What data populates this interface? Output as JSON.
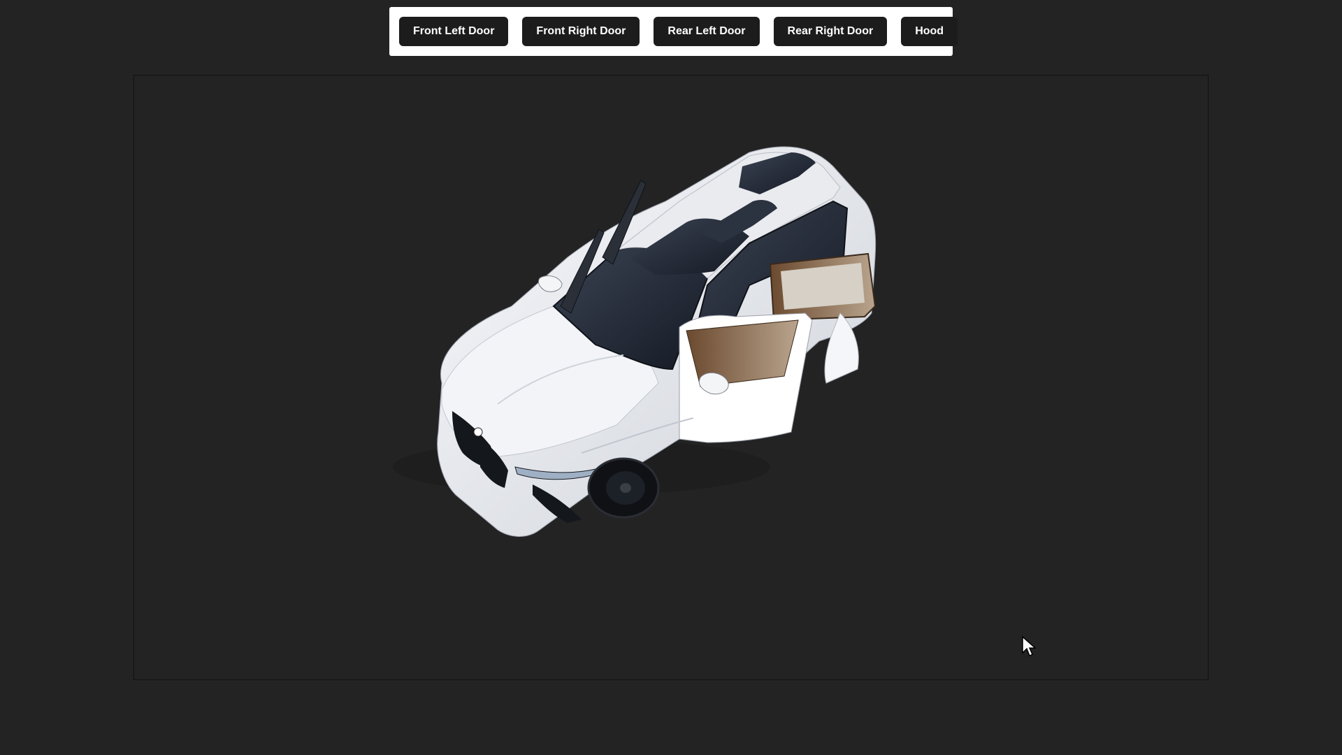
{
  "toolbar": {
    "buttons": [
      {
        "label": "Front Left Door"
      },
      {
        "label": "Front Right Door"
      },
      {
        "label": "Rear Left Door"
      },
      {
        "label": "Rear Right Door"
      },
      {
        "label": "Hood"
      }
    ]
  },
  "viewport": {
    "model_icon": "suv-3d-model"
  },
  "colors": {
    "background": "#232323",
    "toolbar_bg": "#ffffff",
    "button_bg": "#1c1c1c",
    "button_text": "#ffffff",
    "car_body": "#eef0f4"
  }
}
